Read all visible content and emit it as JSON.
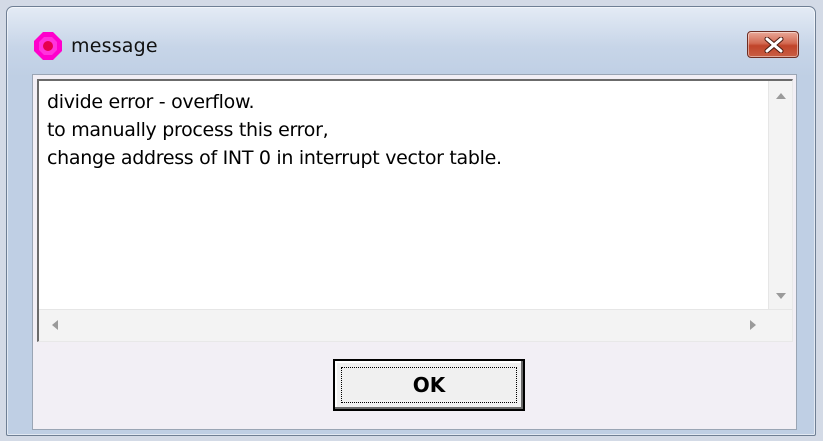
{
  "window": {
    "title": "message",
    "title_icon": "pink-circle-icon",
    "close_icon": "close-x-icon"
  },
  "message": {
    "lines": [
      "divide error - overflow.",
      "to manually process this error,",
      "change address of INT 0 in interrupt vector table."
    ]
  },
  "scrollbars": {
    "up_icon": "scroll-up-arrow-icon",
    "down_icon": "scroll-down-arrow-icon",
    "left_icon": "scroll-left-arrow-icon",
    "right_icon": "scroll-right-arrow-icon"
  },
  "buttons": {
    "ok_label": "OK"
  },
  "colors": {
    "title_icon": "#ff00cc",
    "close_button": "#c9553c",
    "client_background": "#f2eff5"
  }
}
